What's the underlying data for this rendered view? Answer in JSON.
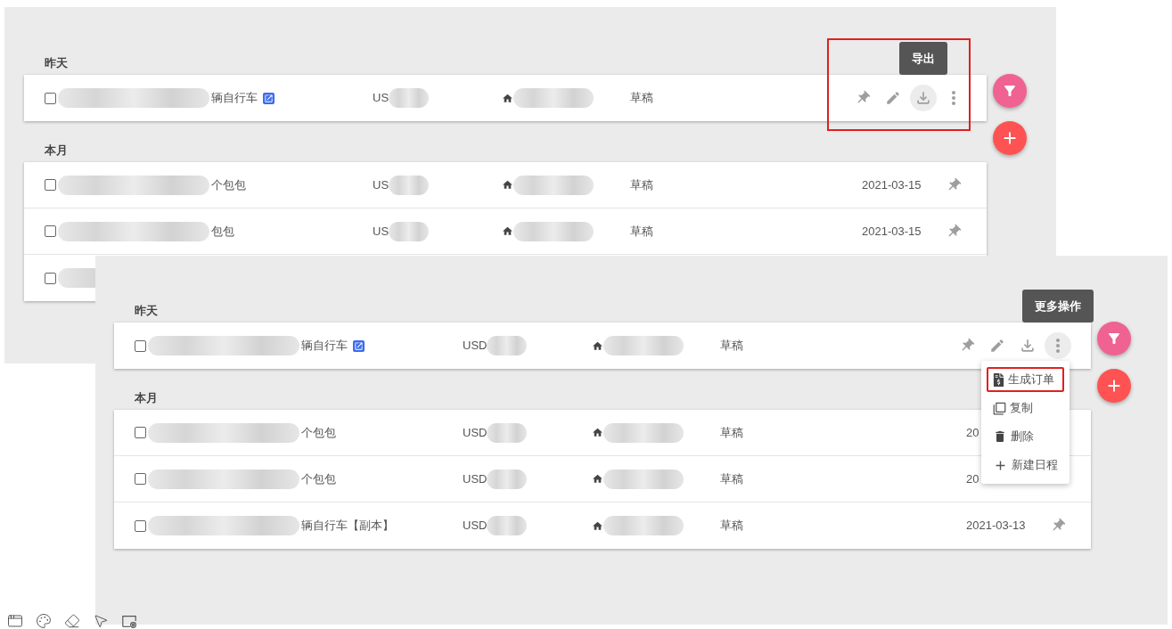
{
  "panels": [
    {
      "groups": [
        {
          "label": "昨天",
          "rows": [
            {
              "kind": "expanded",
              "checked": false,
              "name": "辆自行车",
              "link": true,
              "currency": "US",
              "status": "草稿",
              "actions": [
                {
                  "kind": "pin",
                  "selected": false
                },
                {
                  "kind": "edit",
                  "selected": false
                },
                {
                  "kind": "export",
                  "selected": true,
                  "tooltip": "导出"
                },
                {
                  "kind": "more",
                  "selected": false
                }
              ]
            }
          ]
        },
        {
          "label": "本月",
          "rows": [
            {
              "kind": "compact",
              "checked": false,
              "name": "个包包",
              "link": false,
              "currency": "US",
              "status": "草稿",
              "date": "2021-03-15",
              "pin": true
            },
            {
              "kind": "compact",
              "checked": false,
              "name": "包包",
              "link": false,
              "currency": "US",
              "status": "草稿",
              "date": "2021-03-15",
              "pin": true
            },
            {
              "kind": "covered",
              "checked": false
            }
          ]
        }
      ],
      "annotated": true
    },
    {
      "groups": [
        {
          "label": "昨天",
          "rows": [
            {
              "kind": "expanded",
              "checked": false,
              "name": "辆自行车",
              "link": true,
              "currency": "USD",
              "status": "草稿",
              "actions": [
                {
                  "kind": "pin",
                  "selected": false
                },
                {
                  "kind": "edit",
                  "selected": false
                },
                {
                  "kind": "export",
                  "selected": false
                },
                {
                  "kind": "more",
                  "selected": true,
                  "tooltip": "更多操作",
                  "menu": [
                    {
                      "kind": "order",
                      "label": "生成订单",
                      "highlighted": true
                    },
                    {
                      "kind": "copy",
                      "label": "复制",
                      "highlighted": false
                    },
                    {
                      "kind": "delete",
                      "label": "删除",
                      "highlighted": false
                    },
                    {
                      "kind": "schedule",
                      "label": "新建日程",
                      "highlighted": false
                    }
                  ]
                }
              ]
            }
          ]
        },
        {
          "label": "本月",
          "rows": [
            {
              "kind": "compact",
              "checked": false,
              "name": "个包包",
              "link": false,
              "currency": "USD",
              "status": "草稿",
              "date": "20",
              "pin": false
            },
            {
              "kind": "compact",
              "checked": false,
              "name": "个包包",
              "link": false,
              "currency": "USD",
              "status": "草稿",
              "date": "20",
              "pin": false
            },
            {
              "kind": "compact",
              "checked": false,
              "name": "辆自行车【副本】",
              "link": false,
              "currency": "USD",
              "status": "草稿",
              "date": "2021-03-13",
              "pin": true
            }
          ]
        }
      ],
      "annotated": false
    }
  ],
  "toolbar": [
    {
      "kind": "screen"
    },
    {
      "kind": "palette"
    },
    {
      "kind": "eraser"
    },
    {
      "kind": "pointer"
    },
    {
      "kind": "frame"
    }
  ]
}
